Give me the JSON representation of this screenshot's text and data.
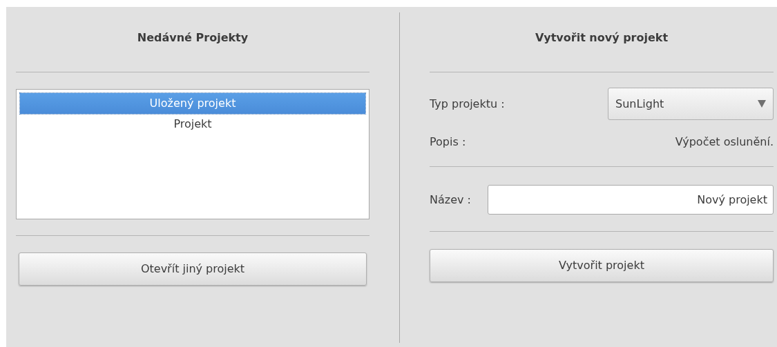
{
  "recent": {
    "title": "Nedávné Projekty",
    "items": [
      {
        "label": "Uložený projekt",
        "selected": true
      },
      {
        "label": "Projekt",
        "selected": false
      }
    ],
    "button": "Otevřít jiný projekt"
  },
  "create": {
    "title": "Vytvořit nový projekt",
    "type_label": "Typ projektu :",
    "type_value": "SunLight",
    "description_label": "Popis :",
    "description": "Výpočet oslunění.",
    "name_label": "Název :",
    "name_value": "Nový projekt",
    "button": "Vytvořit projekt"
  }
}
